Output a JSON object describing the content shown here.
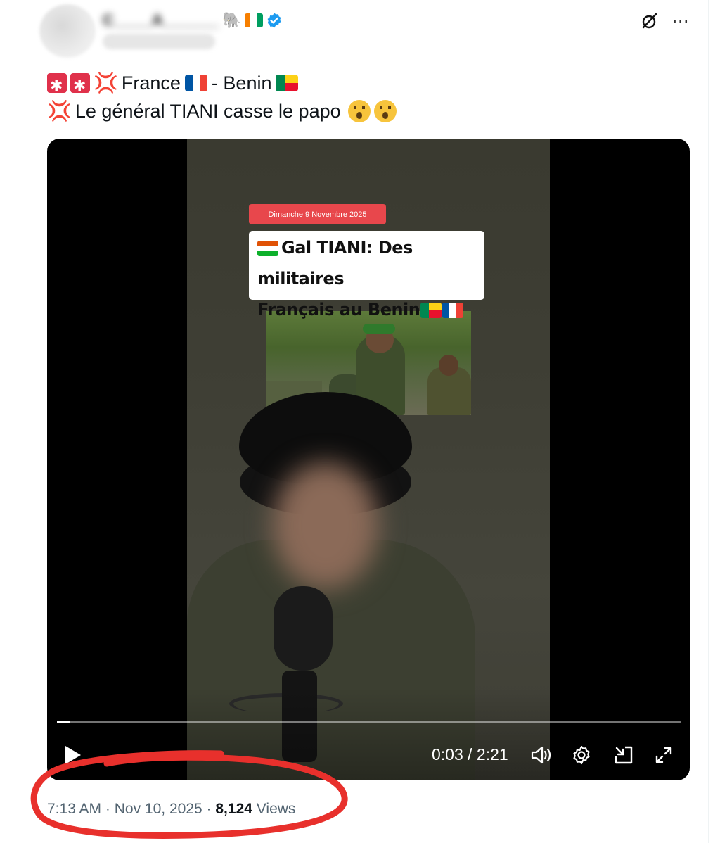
{
  "tweet": {
    "text_line1": {
      "word1": "France",
      "word2": "- Benin"
    },
    "text_line2": "Le général TIANI casse le papo"
  },
  "video": {
    "date_tag": "Dimanche 9 Novembre 2025",
    "caption_line1": "Gal TIANI: Des militaires",
    "caption_line2": "Français au Benin",
    "time": "0:03 / 2:21",
    "progress": 0.02
  },
  "meta": {
    "time": "7:13 AM",
    "sep1": "·",
    "date": "Nov 10, 2025",
    "sep2": "·",
    "views_count": "8,124",
    "views_label": "Views"
  },
  "icons": {
    "more": "⋯",
    "grok": "grok-icon",
    "verified": "verified-badge-icon",
    "play": "play-icon",
    "volume": "volume-icon",
    "settings": "gear-icon",
    "pip": "picture-in-picture-icon",
    "fullscreen": "fullscreen-icon"
  },
  "colors": {
    "verified": "#1d9bf0",
    "annotation_circle": "#e8302c",
    "date_tag": "#e8474c",
    "meta_text": "#536471"
  }
}
